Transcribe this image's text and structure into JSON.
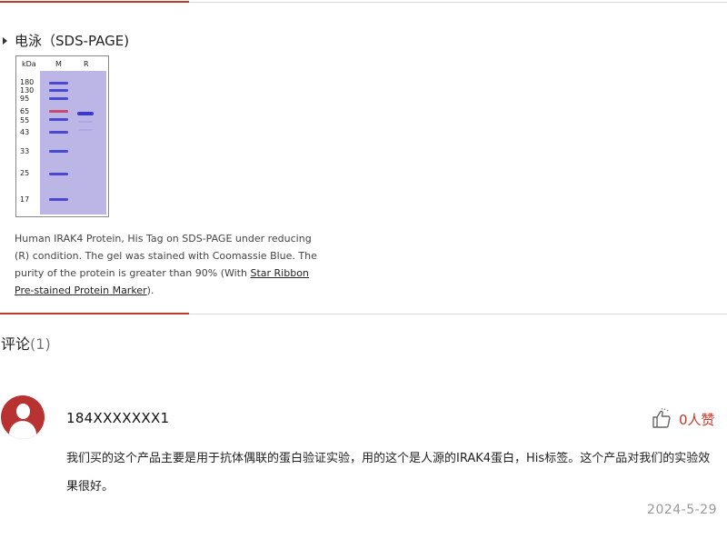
{
  "section": {
    "title": "电泳（SDS-PAGE)"
  },
  "gel": {
    "unit_label": "kDa",
    "lane_labels": [
      "M",
      "R"
    ],
    "markers": [
      "180",
      "130",
      "95",
      "65",
      "55",
      "43",
      "33",
      "25",
      "17"
    ]
  },
  "caption": {
    "text": "Human IRAK4 Protein, His Tag on SDS-PAGE under reducing (R) condition. The gel was stained with Coomassie Blue. The purity of the protein is greater than 90% (With ",
    "link": "Star Ribbon Pre-stained Protein Marker",
    "suffix": ")."
  },
  "comments": {
    "label": "评论",
    "count": "(1)",
    "items": [
      {
        "user": "184XXXXXXX1",
        "likes": "0人赞",
        "text": "我们买的这个产品主要是用于抗体偶联的蛋白验证实验，用的这个是人源的IRAK4蛋白，His标签。这个产品对我们的实验效果很好。",
        "date": "2024-5-29"
      }
    ]
  },
  "colors": {
    "accent": "#c0392b",
    "gel": "#bcb6e6",
    "band": "#4b48cf"
  },
  "icons": {
    "like": "thumbs-up-icon",
    "avatar": "user-avatar-icon",
    "bullet": "triangle-bullet-icon"
  }
}
